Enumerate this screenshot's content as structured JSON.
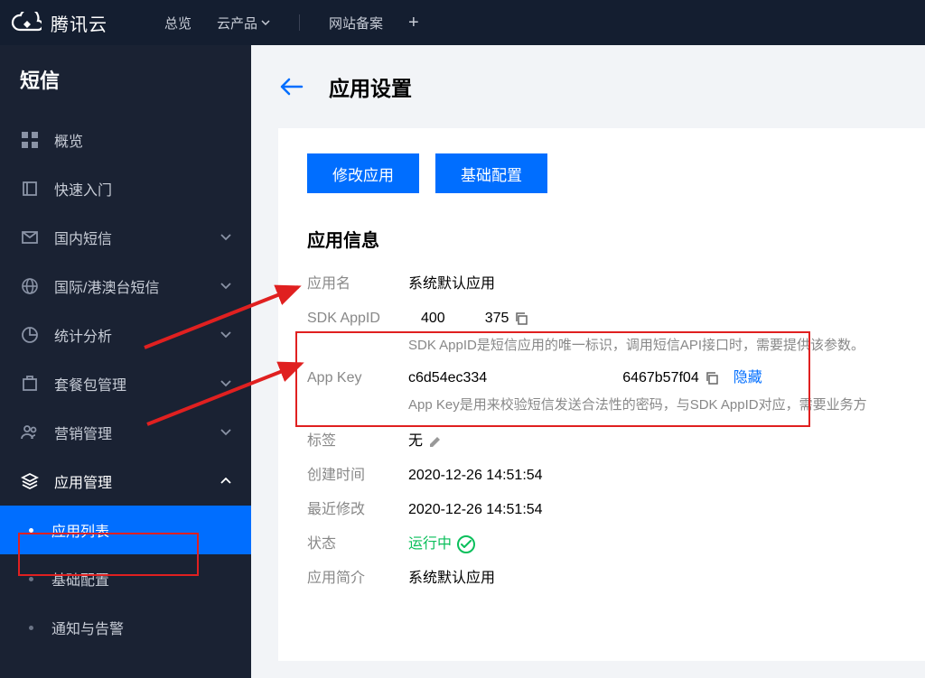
{
  "brand": "腾讯云",
  "top_nav": {
    "overview": "总览",
    "products": "云产品",
    "beian": "网站备案"
  },
  "sidebar": {
    "title": "短信",
    "items": [
      {
        "label": "概览"
      },
      {
        "label": "快速入门"
      },
      {
        "label": "国内短信"
      },
      {
        "label": "国际/港澳台短信"
      },
      {
        "label": "统计分析"
      },
      {
        "label": "套餐包管理"
      },
      {
        "label": "营销管理"
      },
      {
        "label": "应用管理"
      }
    ],
    "subs": [
      {
        "label": "应用列表"
      },
      {
        "label": "基础配置"
      },
      {
        "label": "通知与告警"
      }
    ]
  },
  "page": {
    "title": "应用设置"
  },
  "tabs": {
    "modify": "修改应用",
    "basic": "基础配置"
  },
  "section_title": "应用信息",
  "fields": {
    "app_name": {
      "label": "应用名",
      "value": "系统默认应用"
    },
    "sdk_appid": {
      "label": "SDK AppID",
      "prefix": "400",
      "suffix": "375",
      "desc": "SDK AppID是短信应用的唯一标识，调用短信API接口时，需要提供该参数。"
    },
    "app_key": {
      "label": "App Key",
      "prefix": "c6d54ec334",
      "suffix": "6467b57f04",
      "hide": "隐藏",
      "desc": "App Key是用来校验短信发送合法性的密码，与SDK AppID对应，需要业务方"
    },
    "tags": {
      "label": "标签",
      "value": "无"
    },
    "created": {
      "label": "创建时间",
      "value": "2020-12-26 14:51:54"
    },
    "modified": {
      "label": "最近修改",
      "value": "2020-12-26 14:51:54"
    },
    "status": {
      "label": "状态",
      "value": "运行中"
    },
    "intro": {
      "label": "应用简介",
      "value": "系统默认应用"
    }
  }
}
